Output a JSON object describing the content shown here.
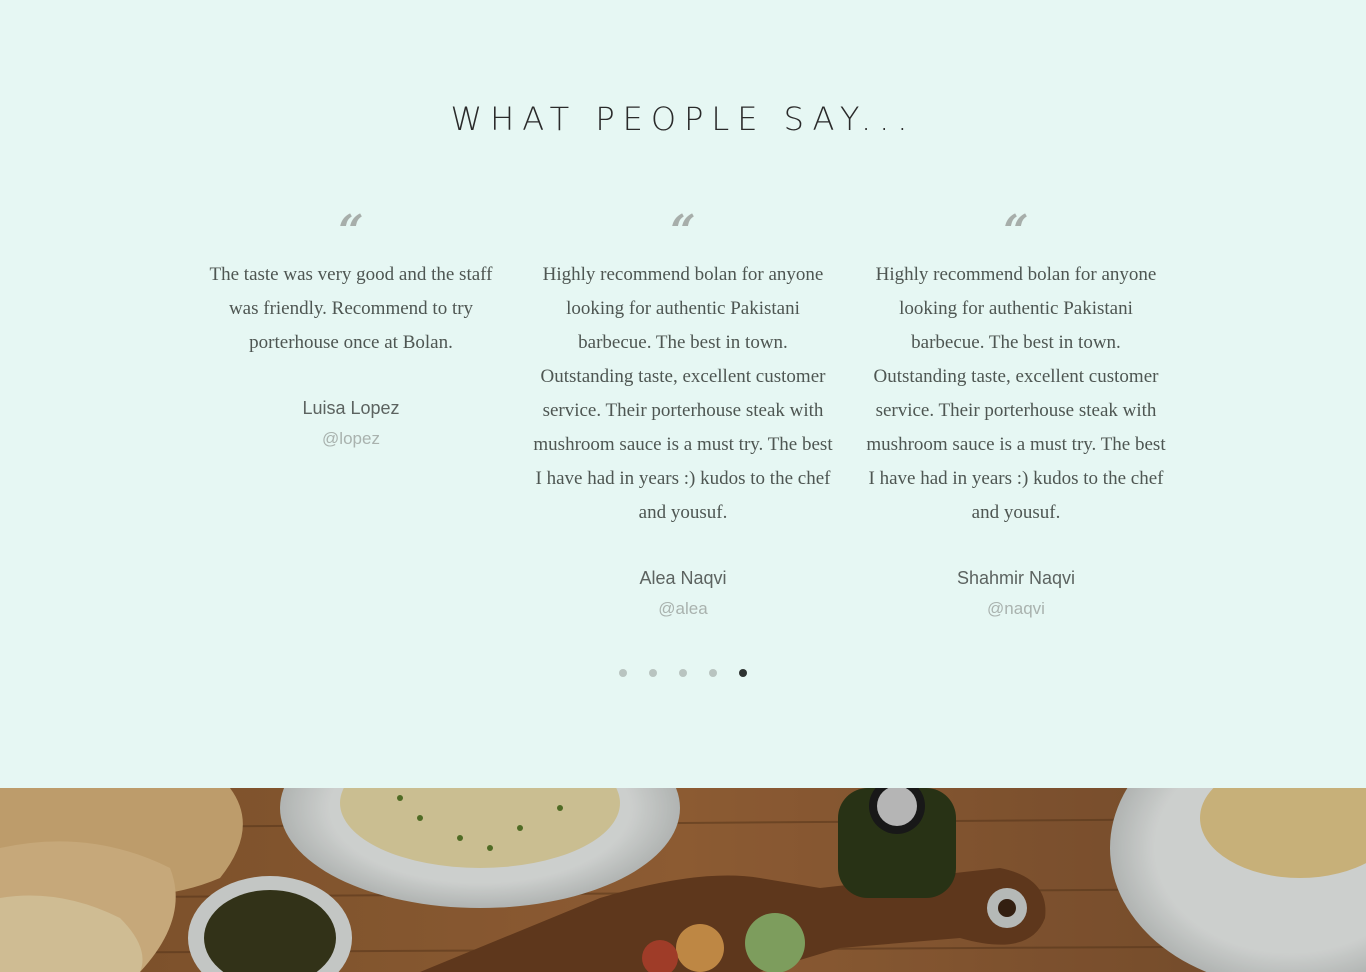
{
  "section": {
    "title": "WHAT PEOPLE SAY..."
  },
  "testimonials": [
    {
      "quote": "The taste was very good and the staff was friendly. Recommend to try porterhouse once at Bolan.",
      "name": "Luisa Lopez",
      "handle": "@lopez"
    },
    {
      "quote": "Highly recommend bolan for anyone looking for authentic Pakistani barbecue. The best in town. Outstanding taste, excellent customer service. Their porterhouse steak with mushroom sauce is a must try. The best I have had in years :) kudos to the chef and yousuf.",
      "name": "Alea Naqvi",
      "handle": "@alea"
    },
    {
      "quote": "Highly recommend bolan for anyone looking for authentic Pakistani barbecue. The best in town. Outstanding taste, excellent customer service. Their porterhouse steak with mushroom sauce is a must try. The best I have had in years :) kudos to the chef and yousuf.",
      "name": "Shahmir Naqvi",
      "handle": "@naqvi"
    }
  ],
  "quote_glyph": "“",
  "pagination": {
    "count": 5,
    "active_index": 4
  },
  "colors": {
    "background": "#e6f7f3",
    "title": "#2a2a2a",
    "quote_mark": "#a7aeaa",
    "text": "#4e5652",
    "handle": "#a9b2ae",
    "dot": "#b9c4c0",
    "dot_active": "#2e3331"
  },
  "photo": {
    "icon": "food-table-photo"
  }
}
